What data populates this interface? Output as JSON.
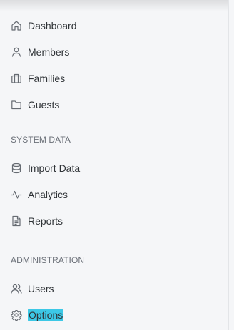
{
  "nav": {
    "main_items": [
      {
        "label": "Dashboard",
        "icon": "home-icon"
      },
      {
        "label": "Members",
        "icon": "user-icon"
      },
      {
        "label": "Families",
        "icon": "briefcase-icon"
      },
      {
        "label": "Guests",
        "icon": "folder-icon"
      }
    ],
    "system_data": {
      "title": "SYSTEM DATA",
      "items": [
        {
          "label": "Import Data",
          "icon": "database-icon"
        },
        {
          "label": "Analytics",
          "icon": "activity-icon"
        },
        {
          "label": "Reports",
          "icon": "document-icon"
        }
      ]
    },
    "administration": {
      "title": "ADMINISTRATION",
      "items": [
        {
          "label": "Users",
          "icon": "users-icon"
        },
        {
          "label": "Options",
          "icon": "gear-icon",
          "highlighted": true
        }
      ]
    }
  },
  "colors": {
    "background": "#f5f6f8",
    "text": "#2f3337",
    "section_title": "#6b7078",
    "icon": "#666b72",
    "highlight": "#3cc8e6"
  }
}
